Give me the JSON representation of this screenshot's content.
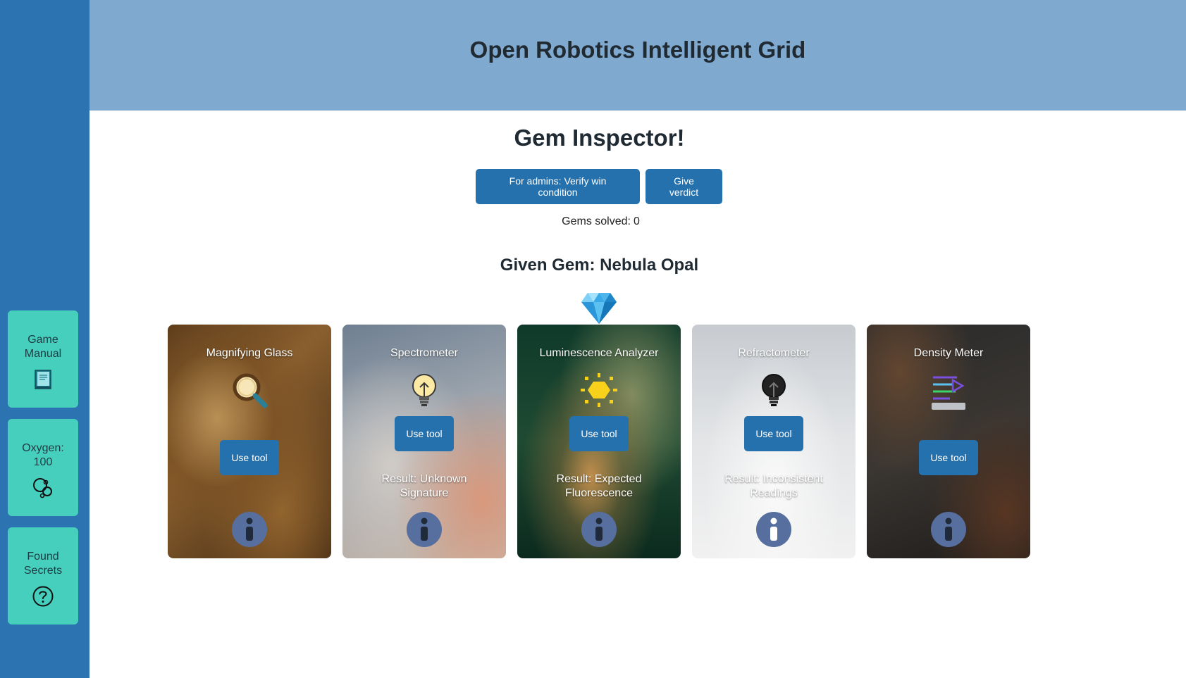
{
  "sidebar": {
    "game_manual": "Game Manual",
    "oxygen": "Oxygen: 100",
    "found_secrets": "Found Secrets"
  },
  "header": {
    "title": "Open Robotics Intelligent Grid"
  },
  "main": {
    "title": "Gem Inspector!",
    "admin_button": "For admins: Verify win condition",
    "verdict_button": "Give verdict",
    "gems_solved_label": "Gems solved:",
    "gems_solved_value": "0",
    "given_gem": "Given Gem: Nebula Opal"
  },
  "tools": [
    {
      "name": "Magnifying Glass",
      "button": "Use tool",
      "result": "",
      "icon": "magnifying-glass-icon"
    },
    {
      "name": "Spectrometer",
      "button": "Use tool",
      "result": "Result: Unknown Signature",
      "icon": "lightbulb-icon"
    },
    {
      "name": "Luminescence Analyzer",
      "button": "Use tool",
      "result": "Result: Expected Fluorescence",
      "icon": "glowing-sun-icon"
    },
    {
      "name": "Refractometer",
      "button": "Use tool",
      "result": "Result: Inconsistent Readings",
      "icon": "dark-lightbulb-icon"
    },
    {
      "name": "Density Meter",
      "button": "Use tool",
      "result": "",
      "icon": "density-meter-icon"
    }
  ],
  "colors": {
    "sidebar_bg": "#2b74b1",
    "sidebar_card": "#47cfbe",
    "header_bg": "#80a9cf",
    "button": "#2471ad",
    "info_button": "#566f9f"
  }
}
